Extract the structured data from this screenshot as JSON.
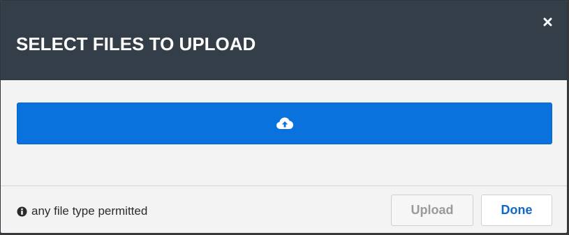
{
  "dialog": {
    "title": "SELECT FILES TO UPLOAD",
    "close_icon": "close-icon"
  },
  "upload_area": {
    "icon": "cloud-upload-icon",
    "color": "#0a72dd"
  },
  "footer": {
    "hint_icon": "info-icon",
    "hint_text": "any file type permitted",
    "upload_label": "Upload",
    "upload_disabled": true,
    "done_label": "Done"
  },
  "colors": {
    "header": "#343e49",
    "accent": "#0a72dd",
    "done_text": "#1068c8"
  }
}
